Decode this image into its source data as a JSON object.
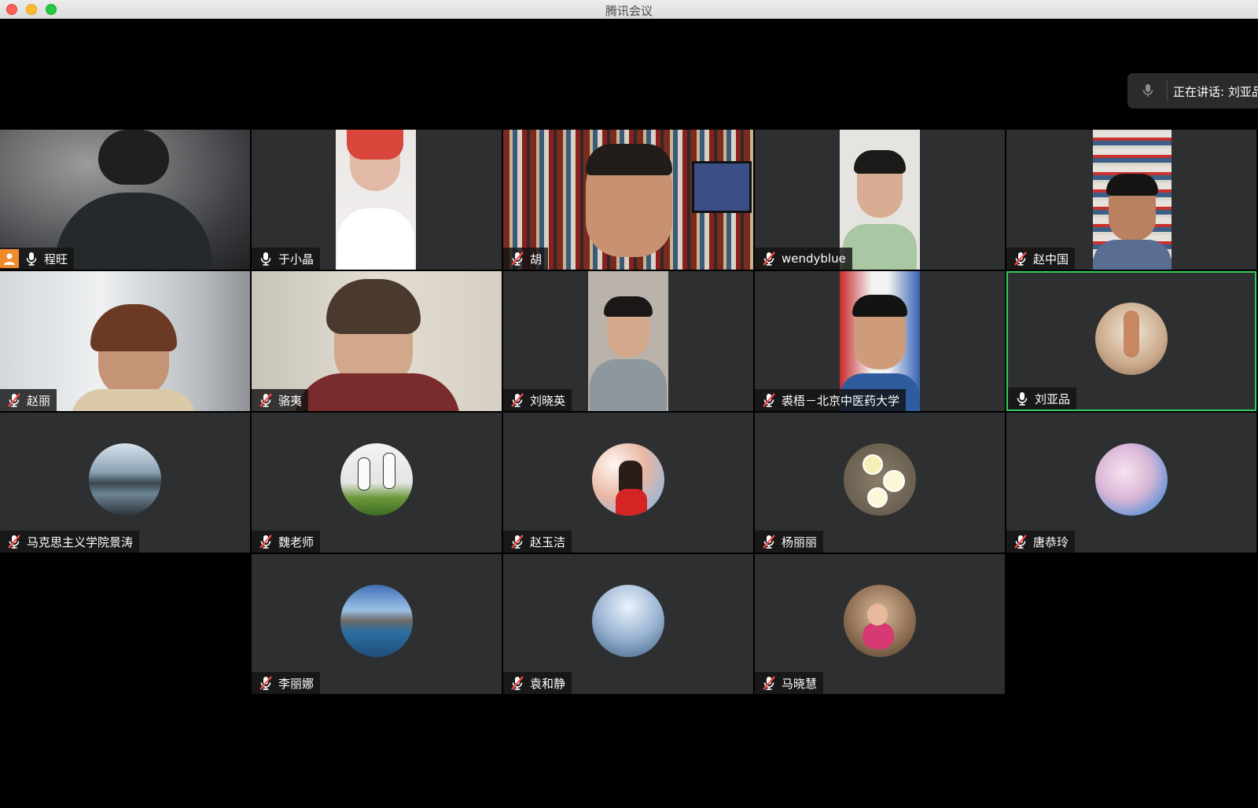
{
  "window": {
    "title": "腾讯会议"
  },
  "speaking": {
    "label": "正在讲话: 刘亚品"
  },
  "participants": [
    {
      "name": "程旺",
      "mic": "on"
    },
    {
      "name": "于小晶",
      "mic": "on"
    },
    {
      "name": "胡",
      "mic": "muted"
    },
    {
      "name": "wendyblue",
      "mic": "muted"
    },
    {
      "name": "赵中国",
      "mic": "muted"
    },
    {
      "name": "赵丽",
      "mic": "muted"
    },
    {
      "name": "骆夷",
      "mic": "muted"
    },
    {
      "name": "刘晓英",
      "mic": "muted"
    },
    {
      "name": "裘梧－北京中医药大学",
      "mic": "muted"
    },
    {
      "name": "刘亚品",
      "mic": "on"
    },
    {
      "name": "马克思主义学院景涛",
      "mic": "muted"
    },
    {
      "name": "魏老师",
      "mic": "muted"
    },
    {
      "name": "赵玉洁",
      "mic": "muted"
    },
    {
      "name": "杨丽丽",
      "mic": "muted"
    },
    {
      "name": "唐恭玲",
      "mic": "muted"
    },
    {
      "name": "李丽娜",
      "mic": "muted"
    },
    {
      "name": "袁和静",
      "mic": "muted"
    },
    {
      "name": "马晓慧",
      "mic": "muted"
    }
  ],
  "icons": {
    "mic_on": "microphone-icon",
    "mic_muted": "microphone-muted-icon",
    "host": "host-icon"
  },
  "colors": {
    "tile_bg": "#2e2f31",
    "active_border": "#2ccf5a",
    "host_badge": "#f08a2a"
  }
}
